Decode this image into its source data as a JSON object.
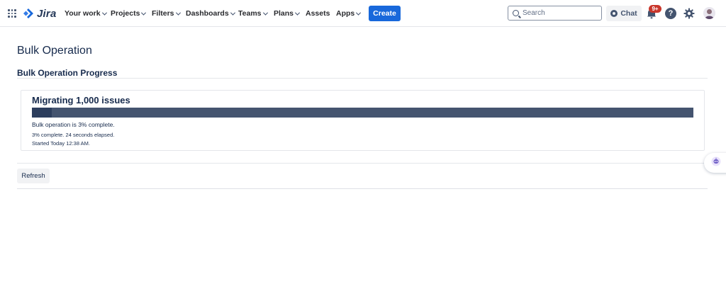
{
  "app": {
    "name": "Jira"
  },
  "nav": {
    "items": [
      {
        "label": "Your work",
        "has_dropdown": true
      },
      {
        "label": "Projects",
        "has_dropdown": true
      },
      {
        "label": "Filters",
        "has_dropdown": true
      },
      {
        "label": "Dashboards",
        "has_dropdown": true
      },
      {
        "label": "Teams",
        "has_dropdown": true
      },
      {
        "label": "Plans",
        "has_dropdown": true
      },
      {
        "label": "Assets",
        "has_dropdown": false
      },
      {
        "label": "Apps",
        "has_dropdown": true
      }
    ],
    "create_label": "Create",
    "search_placeholder": "Search",
    "chat_label": "Chat",
    "notification_badge": "9+",
    "help_glyph": "?"
  },
  "page": {
    "title": "Bulk Operation",
    "section_title": "Bulk Operation Progress"
  },
  "progress": {
    "operation_title": "Migrating 1,000 issues",
    "percent": 3,
    "status_main": "Bulk operation is 3% complete.",
    "status_elapsed": "3% complete. 24 seconds elapsed.",
    "status_started": "Started Today 12:38 AM."
  },
  "actions": {
    "refresh_label": "Refresh"
  },
  "colors": {
    "brand": "#1868db",
    "progress_bar": "#44546f",
    "badge": "#c9372c",
    "text": "#172b4d"
  },
  "icons": [
    "app-switcher-icon",
    "jira-logo-icon",
    "search-icon",
    "chat-icon",
    "notification-bell-icon",
    "help-icon",
    "gear-icon",
    "avatar",
    "assistant-icon"
  ]
}
